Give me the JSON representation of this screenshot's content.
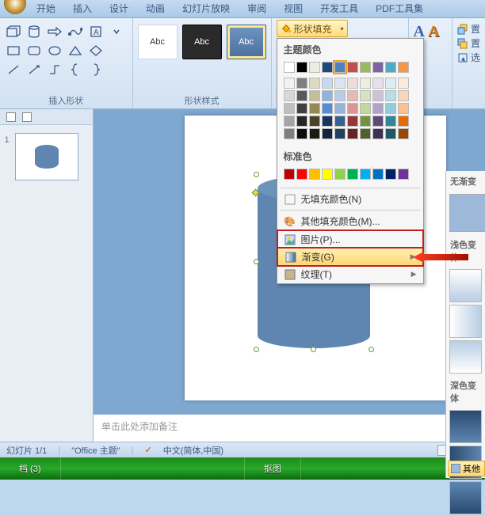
{
  "tabs": {
    "items": [
      {
        "label": "开始"
      },
      {
        "label": "插入"
      },
      {
        "label": "设计"
      },
      {
        "label": "动画"
      },
      {
        "label": "幻灯片放映"
      },
      {
        "label": "审阅"
      },
      {
        "label": "视图"
      },
      {
        "label": "开发工具"
      },
      {
        "label": "PDF工具集"
      }
    ]
  },
  "ribbon": {
    "insert_shapes_label": "插入形状",
    "shape_styles_label": "形状样式",
    "style_sample_text": "Abc",
    "fill_button": "形状填充",
    "side_a": "置",
    "side_b": "置",
    "side_c": "选"
  },
  "fill_menu": {
    "theme_colors_title": "主题颜色",
    "standard_colors_title": "标准色",
    "no_fill": "无填充颜色(N)",
    "more_colors": "其他填充颜色(M)...",
    "picture": "图片(P)...",
    "gradient": "渐变(G)",
    "texture": "纹理(T)",
    "theme_rows": [
      [
        "#ffffff",
        "#000000",
        "#eeece1",
        "#1f497d",
        "#4f81bd",
        "#c0504d",
        "#9bbb59",
        "#8064a2",
        "#4bacc6",
        "#f79646"
      ],
      [
        "#f2f2f2",
        "#7f7f7f",
        "#ddd9c3",
        "#c6d9f0",
        "#dbe5f1",
        "#f2dcdb",
        "#ebf1dd",
        "#e5e0ec",
        "#dbeef3",
        "#fdeada"
      ],
      [
        "#d8d8d8",
        "#595959",
        "#c4bd97",
        "#8db3e2",
        "#b8cce4",
        "#e5b9b7",
        "#d7e3bc",
        "#ccc1d9",
        "#b7dde8",
        "#fbd5b5"
      ],
      [
        "#bfbfbf",
        "#3f3f3f",
        "#938953",
        "#548dd4",
        "#95b3d7",
        "#d99694",
        "#c3d69b",
        "#b2a2c7",
        "#92cddc",
        "#fac08f"
      ],
      [
        "#a5a5a5",
        "#262626",
        "#494429",
        "#17365d",
        "#366092",
        "#953734",
        "#76923c",
        "#5f497a",
        "#31859b",
        "#e36c09"
      ],
      [
        "#7f7f7f",
        "#0c0c0c",
        "#1d1b10",
        "#0f243e",
        "#244061",
        "#632423",
        "#4f6128",
        "#3f3151",
        "#205867",
        "#974806"
      ]
    ],
    "standard_row": [
      "#c00000",
      "#ff0000",
      "#ffc000",
      "#ffff00",
      "#92d050",
      "#00b050",
      "#00b0f0",
      "#0070c0",
      "#002060",
      "#7030a0"
    ],
    "selected_swatch": "#4f81bd"
  },
  "grad_menu": {
    "no_grad": "无渐变",
    "light_var": "浅色变体",
    "dark_var": "深色变体",
    "other": "其他"
  },
  "slide": {
    "notes_placeholder": "单击此处添加备注"
  },
  "status": {
    "slide_count": "幻灯片 1/1",
    "theme": "\"Office 主题\"",
    "lang": "中文(简体,中国)"
  },
  "taskbar": {
    "a": "档 (3)",
    "b": "抠图"
  }
}
